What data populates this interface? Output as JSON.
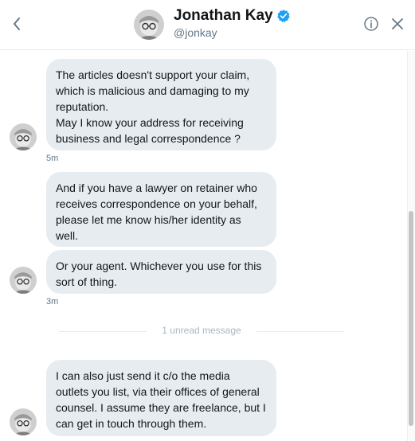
{
  "header": {
    "name": "Jonathan Kay",
    "handle": "@jonkay",
    "verified": true,
    "accent_color": "#1da1f2"
  },
  "icons": {
    "back": "chevron-left-icon",
    "info": "info-icon",
    "close": "close-icon",
    "verified": "verified-badge-icon"
  },
  "messages": [
    {
      "text": "The articles doesn't support your claim,\nwhich is malicious and damaging to my\nreputation.\nMay I know your address for receiving\nbusiness and legal correspondence ?"
    },
    {
      "text": "And if you have a lawyer on retainer who\nreceives correspondence on your behalf,\nplease let me know his/her identity as\nwell."
    },
    {
      "text": "Or your agent. Whichever you use for this\nsort of thing."
    },
    {
      "text": "I can also just send it c/o the media\noutlets you list, via their offices of general\ncounsel. I assume they are freelance, but I\ncan get in touch through them."
    }
  ],
  "timestamps": [
    "5m",
    "3m"
  ],
  "unread_divider": "1 unread message"
}
